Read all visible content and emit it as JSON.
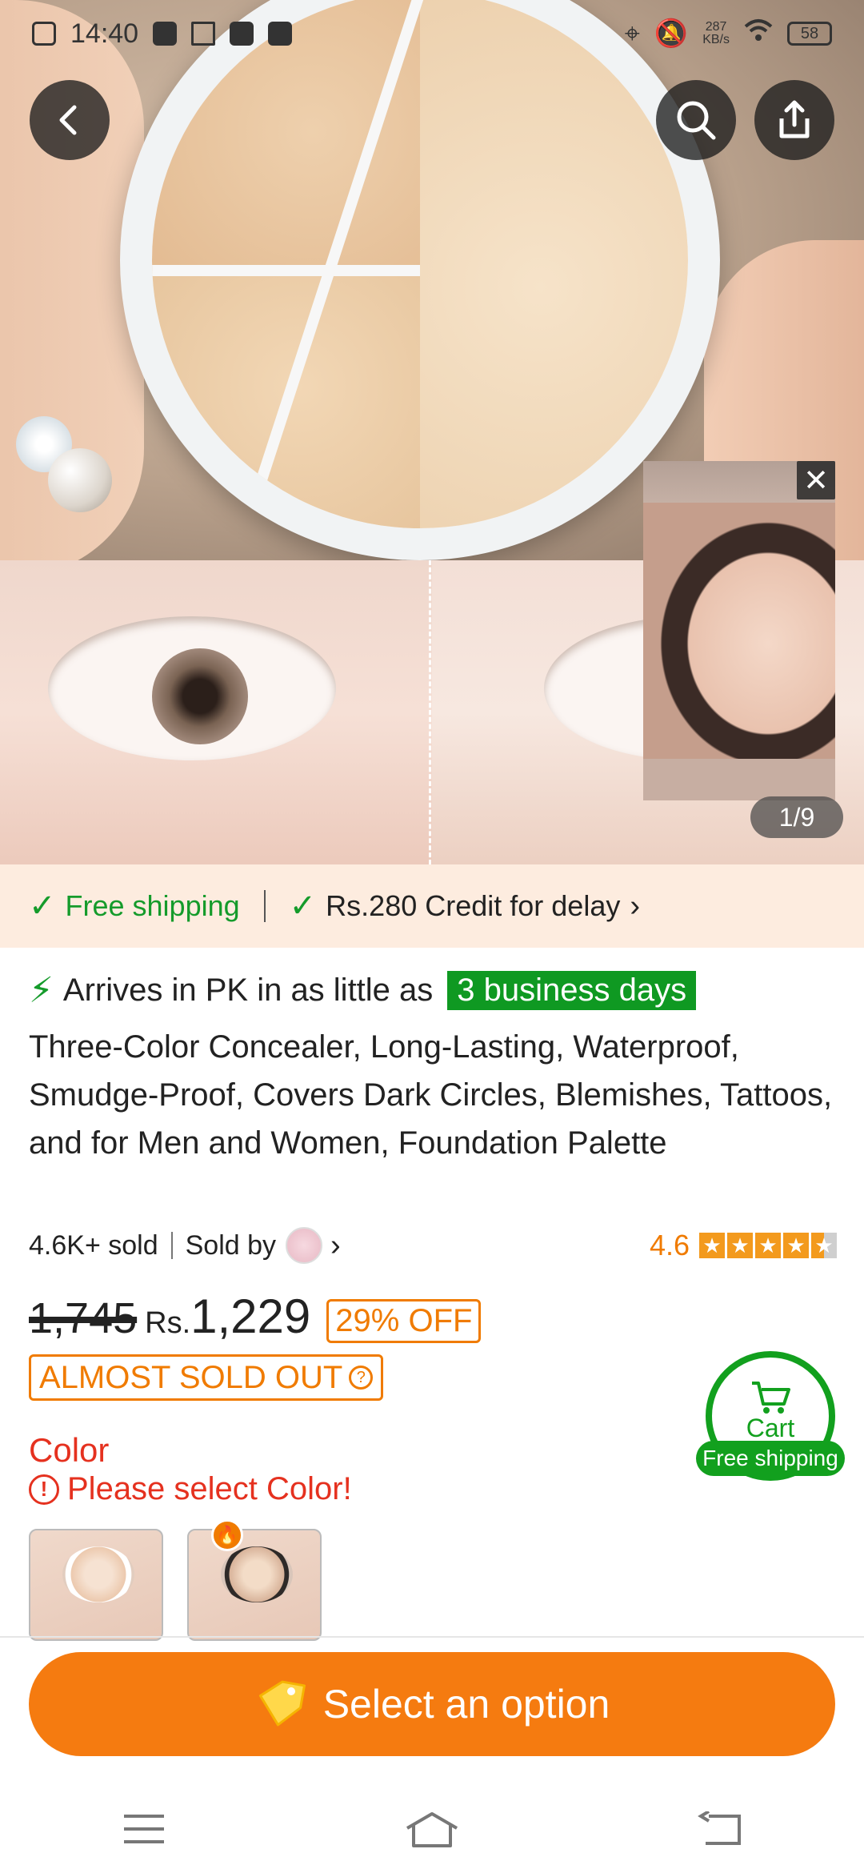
{
  "status_bar": {
    "time": "14:40",
    "net_speed_value": "287",
    "net_speed_unit": "KB/s",
    "battery": "58"
  },
  "gallery": {
    "counter": "1/9",
    "close_glyph": "✕"
  },
  "shipping": {
    "free_label": "Free shipping",
    "credit_label": "Rs.280 Credit for delay"
  },
  "delivery": {
    "prefix": "Arrives in PK in as little as",
    "days": "3 business days"
  },
  "product": {
    "title": "Three-Color Concealer, Long-Lasting, Waterproof, Smudge-Proof, Covers Dark Circles, Blemishes, Tattoos, and for Men and Women, Foundation Palette",
    "sold": "4.6K+ sold",
    "sold_by": "Sold by",
    "rating": "4.6",
    "rating_stars": 4.6
  },
  "price": {
    "original": "1,745",
    "currency": "Rs.",
    "current": "1,229",
    "discount": "29% OFF",
    "stock_badge": "ALMOST SOLD OUT"
  },
  "variant": {
    "label": "Color",
    "warning": "Please select Color!"
  },
  "cart": {
    "label": "Cart",
    "badge": "Free shipping"
  },
  "cta": {
    "label": "Select an option"
  },
  "colors": {
    "accent": "#f57b10",
    "green": "#12a01e",
    "error": "#e5311f"
  }
}
